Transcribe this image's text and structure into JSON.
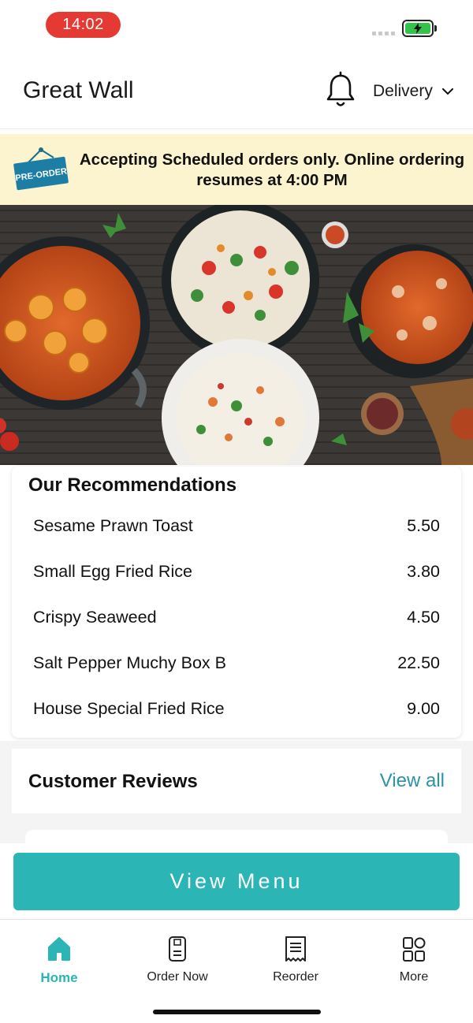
{
  "status_bar": {
    "time": "14:02"
  },
  "header": {
    "title": "Great Wall",
    "mode": "Delivery"
  },
  "banner": {
    "badge": "PRE-ORDER",
    "message": "Accepting Scheduled orders only. Online ordering resumes at 4:00 PM"
  },
  "recommendations": {
    "title": "Our Recommendations",
    "items": [
      {
        "name": "Sesame Prawn Toast",
        "price": "5.50"
      },
      {
        "name": "Small Egg Fried Rice",
        "price": "3.80"
      },
      {
        "name": "Crispy Seaweed",
        "price": "4.50"
      },
      {
        "name": "Salt Pepper Muchy Box B",
        "price": "22.50"
      },
      {
        "name": "House Special Fried Rice",
        "price": "9.00"
      }
    ]
  },
  "reviews": {
    "title": "Customer Reviews",
    "view_all": "View all"
  },
  "cta": {
    "label": "View Menu"
  },
  "bottom_nav": {
    "items": [
      {
        "label": "Home",
        "icon": "home-icon",
        "active": true
      },
      {
        "label": "Order Now",
        "icon": "order-now-icon",
        "active": false
      },
      {
        "label": "Reorder",
        "icon": "reorder-icon",
        "active": false
      },
      {
        "label": "More",
        "icon": "more-grid-icon",
        "active": false
      }
    ]
  },
  "colors": {
    "accent": "#2bb5b4",
    "link": "#2a93a8",
    "banner_bg": "#fcf4cf",
    "time_pill": "#e53a34"
  }
}
